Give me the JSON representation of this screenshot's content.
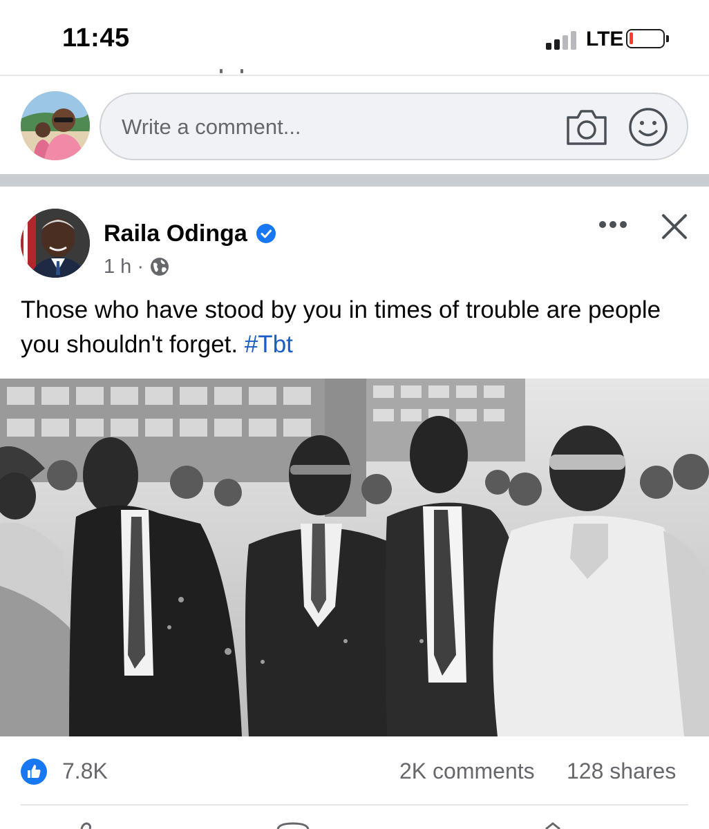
{
  "status_bar": {
    "time": "11:45",
    "network": "LTE",
    "signal_bars_active": 2,
    "signal_bars_total": 4,
    "battery_level": 0.1
  },
  "comment_bar": {
    "placeholder": "Write a comment...",
    "camera_icon": "camera-icon",
    "emoji_icon": "emoji-icon"
  },
  "post": {
    "author": "Raila Odinga",
    "verified": true,
    "time": "1 h",
    "dot": "·",
    "audience_icon": "globe-icon",
    "text": "Those who have stood by you in times of trouble are people you shouldn't forget. ",
    "hashtag": "#Tbt",
    "photo": "black-and-white group photo of men in suits walking in a crowd"
  },
  "stats": {
    "likes": "7.8K",
    "comments": "2K comments",
    "shares": "128 shares"
  },
  "colors": {
    "accent": "#1877f2",
    "hashtag": "#1b5cc7",
    "muted_text": "#65676b",
    "separator": "#c9ccd1",
    "battery_low": "#ff3b30"
  }
}
